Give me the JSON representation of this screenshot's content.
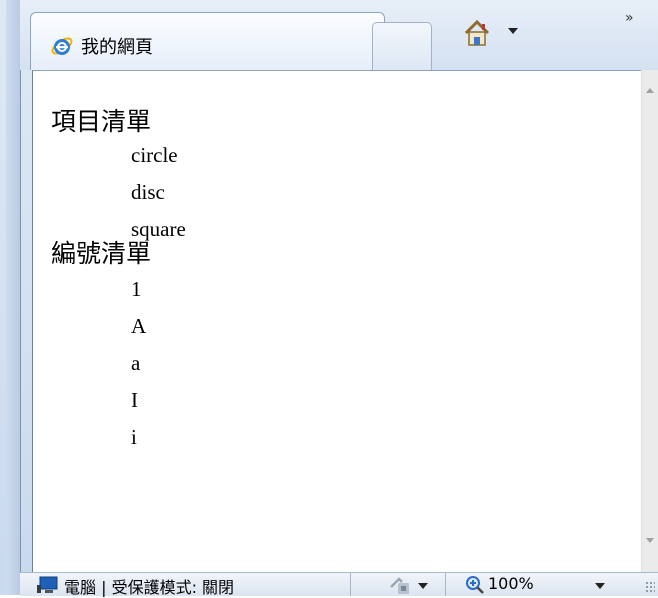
{
  "tab": {
    "title": "我的網頁",
    "icon": "ie-logo-icon"
  },
  "toolbar": {
    "home_icon": "home-icon",
    "overflow": "»"
  },
  "page": {
    "unordered_heading": "項目清單",
    "unordered_items": [
      "circle",
      "disc",
      "square"
    ],
    "ordered_heading": "編號清單",
    "ordered_items": [
      "1",
      "A",
      "a",
      "I",
      "i"
    ]
  },
  "status": {
    "zone_text": "電腦 | 受保護模式: 關閉",
    "zoom_text": "100%"
  },
  "colors": {
    "frame": "#c9d9ee",
    "accent": "#1a73c8"
  }
}
